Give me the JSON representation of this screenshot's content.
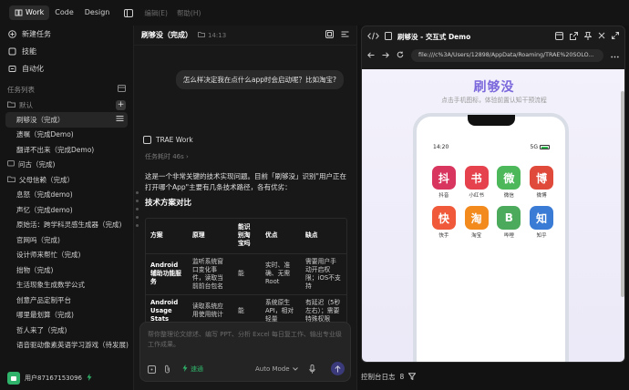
{
  "topbar": {
    "modes": [
      {
        "label": "Work"
      },
      {
        "label": "Code"
      },
      {
        "label": "Design"
      }
    ],
    "menus": [
      {
        "label": "编辑(E)"
      },
      {
        "label": "帮助(H)"
      }
    ]
  },
  "sidebar": {
    "nav": [
      {
        "label": "新建任务"
      },
      {
        "label": "技能"
      },
      {
        "label": "自动化"
      }
    ],
    "tasklist_title": "任务列表",
    "default_group": "默认",
    "tasks": [
      {
        "label": "刷够没（完成）"
      },
      {
        "label": "遗嘱（完成Demo)"
      },
      {
        "label": "翻译不出来（完成Demo)"
      },
      {
        "label": "问古（完成)"
      }
    ],
    "folder": {
      "label": "父母信赖（完成）"
    },
    "folder_tasks": [
      {
        "label": "息怒（完成demo)"
      },
      {
        "label": "声忆（完成demo)"
      },
      {
        "label": "原始活：跨学科灵感生成器（完成)"
      },
      {
        "label": "官网吗（完成)"
      },
      {
        "label": "设计师来帮忙（完成)"
      },
      {
        "label": "拙物（完成)"
      },
      {
        "label": "生活现象生成数学公式"
      },
      {
        "label": "创意产品定制平台"
      },
      {
        "label": "哪里最划算（完成)"
      },
      {
        "label": "哲人来了（完成)"
      },
      {
        "label": "语音驱动像素英语学习游戏（待发展)"
      }
    ],
    "user": "用户87167153096"
  },
  "chat": {
    "title": "刷够没（完成）",
    "time": "14:13",
    "user_message": "怎么样决定我在点什么app时会启动呢？比如淘宝?",
    "agent_name": "TRAE Work",
    "task_duration": "任务耗时 46s",
    "answer": "这是一个非常关键的技术实现问题。目前「刷够没」识别\"用户正在打开哪个App\"主要有几条技术路径，各有优劣：",
    "heading": "技术方案对比",
    "table": {
      "headers": [
        "方案",
        "原理",
        "能识别淘宝吗",
        "优点",
        "缺点"
      ],
      "rows": [
        [
          "Android 辅助功能服务",
          "监听系统窗口变化事件，读取当前前台包名",
          "能",
          "实时、准确、无需 Root",
          "需要用户手动开启权限；iOS不支持"
        ],
        [
          "Android Usage Stats",
          "读取系统应用使用统计",
          "能",
          "系统原生API，相对轻量",
          "有延迟（5秒左右）；需要特殊权限"
        ]
      ]
    },
    "input_placeholder": "帮你整理论文综述、编写 PPT、分析 Excel 每日复工作、输出专业级工作成果。",
    "quick_label": "速通",
    "mode_label": "Auto Mode"
  },
  "preview": {
    "title": "刷够没 - 交互式 Demo",
    "url": "file:///c%3A/Users/12898/AppData/Roaming/TRAE%20SOLO...",
    "page_title": "刷够没",
    "page_subtitle": "点击手机图标，体验前置认知干预流程",
    "phone_time": "14:20",
    "phone_signal": "5G",
    "apps": [
      {
        "glyph": "抖",
        "label": "抖音",
        "color": "#d9365f"
      },
      {
        "glyph": "书",
        "label": "小红书",
        "color": "#e5424d"
      },
      {
        "glyph": "微",
        "label": "微信",
        "color": "#4cb85a"
      },
      {
        "glyph": "博",
        "label": "微博",
        "color": "#e04a3a"
      },
      {
        "glyph": "快",
        "label": "快手",
        "color": "#f05a3a"
      },
      {
        "glyph": "淘",
        "label": "淘宝",
        "color": "#f28a1e"
      },
      {
        "glyph": "B",
        "label": "哔哩",
        "color": "#4caa5c"
      },
      {
        "glyph": "知",
        "label": "知乎",
        "color": "#3a7bd5"
      }
    ]
  },
  "bottom": {
    "console_label": "控制台日志",
    "console_count": "8"
  }
}
